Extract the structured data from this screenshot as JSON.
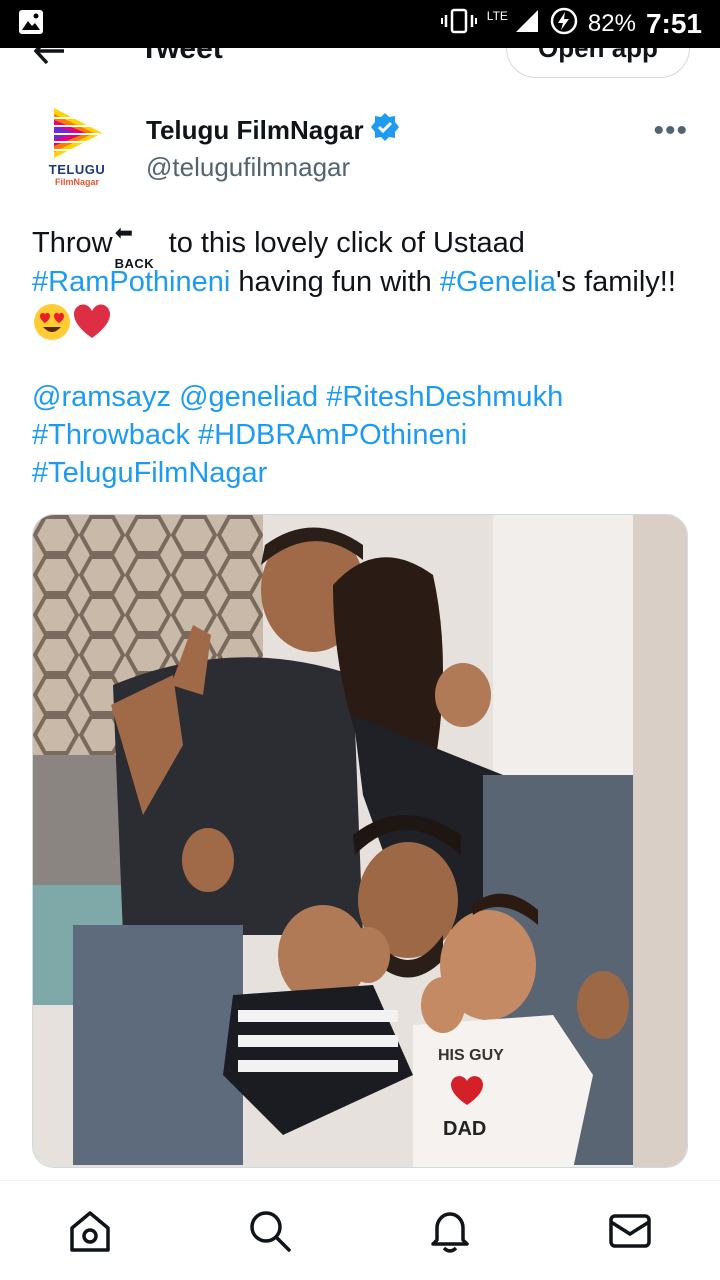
{
  "status_bar": {
    "network": "LTE",
    "battery": "82%",
    "time": "7:51"
  },
  "header": {
    "title": "Tweet",
    "open_app_label": "Open app"
  },
  "author": {
    "name": "Telugu FilmNagar",
    "handle": "@telugufilmnagar",
    "avatar_text_line1": "TELUGU",
    "avatar_text_line2": "FilmNagar",
    "verified": true,
    "more_label": "•••"
  },
  "tweet": {
    "text_throw": "Throw",
    "back_badge": "BACK",
    "text_part1": " to this lovely click of Ustaad",
    "hashtag_ram": "#RamPothineni",
    "text_part2": " having fun with ",
    "hashtag_genelia": "#Genelia",
    "text_part3": "'s family!!",
    "mentions": [
      "@ramsayz",
      "@geneliad",
      "#RiteshDeshmukh",
      "#Throwback",
      "#HDBRAmPOthineni",
      "#TeluguFilmNagar"
    ]
  },
  "photo": {
    "shirt_text_1": "HIS GUY",
    "shirt_text_2": "DAD"
  },
  "bottom_nav": {
    "items": [
      "home-icon",
      "search-icon",
      "notifications-icon",
      "messages-icon"
    ]
  },
  "colors": {
    "accent": "#1d9bf0",
    "text": "#0f1419",
    "muted": "#536471"
  }
}
